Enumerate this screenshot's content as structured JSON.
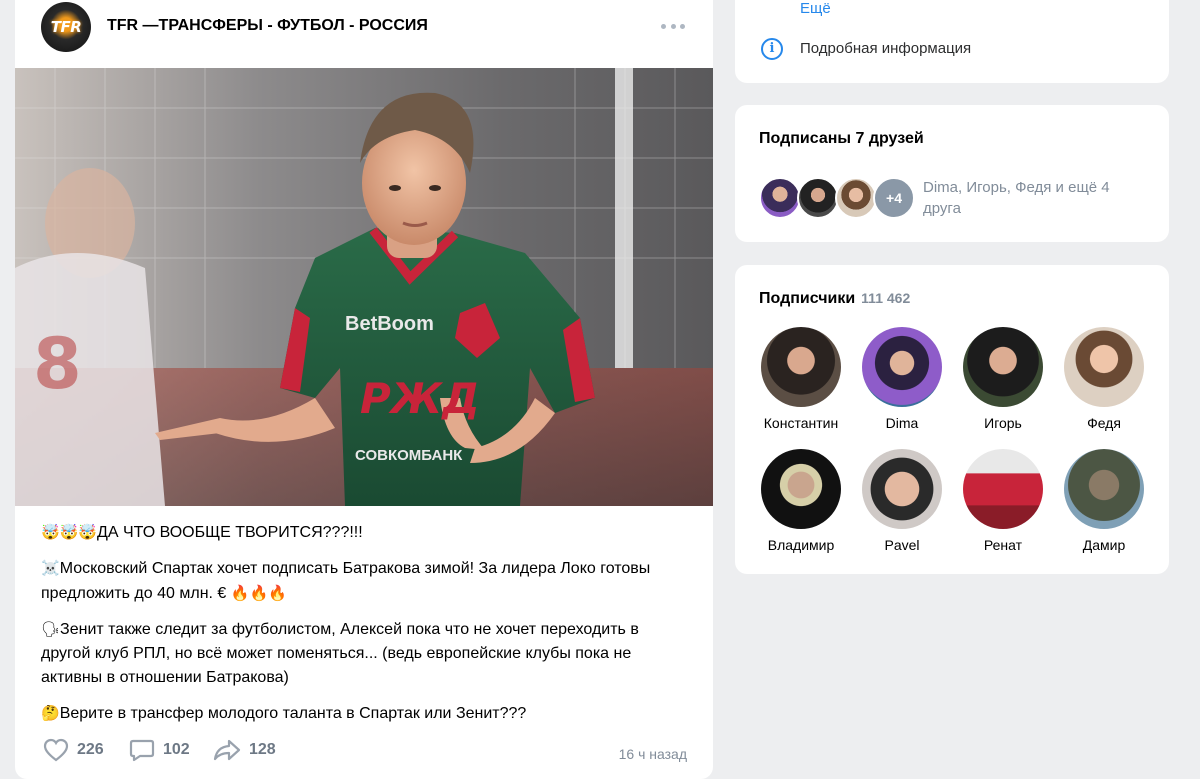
{
  "post": {
    "group_name": "TFR —ТРАНСФЕРЫ - ФУТБОЛ - РОССИЯ",
    "logo_text": "TFR",
    "photo_text": {
      "sponsor": "BetBoom",
      "chest": "РЖД",
      "bank": "СОВКОМБАНК"
    },
    "lines": [
      {
        "emoji": "🤯🤯🤯",
        "text": "ДА ЧТО ВООБЩЕ ТВОРИТСЯ???!!!"
      },
      {
        "emoji": "☠️",
        "text": "Московский Спартак хочет подписать Батракова зимой! За лидера Локо готовы предложить до 40 млн. €",
        "emoji_after": "🔥🔥🔥"
      },
      {
        "emoji": "🗣",
        "text": "Зенит также следит за футболистом, Алексей пока что не хочет переходить в другой клуб РПЛ, но всё может поменяться... (ведь европейские клубы пока не активны в отношении Батракова)"
      },
      {
        "emoji": "🤔",
        "text": "Верите в трансфер молодого таланта в Спартак или Зенит???"
      }
    ],
    "likes": "226",
    "comments": "102",
    "shares": "128",
    "timestamp": "16 ч назад"
  },
  "sidebar": {
    "more_label": "Ещё",
    "info_label": "Подробная информация",
    "friends": {
      "title": "Подписаны 7 друзей",
      "more_badge": "+4",
      "summary": "Dima, Игорь, Федя и ещё 4 друга"
    },
    "subscribers": {
      "title": "Подписчики",
      "count": "111 462",
      "people": [
        {
          "name": "Константин"
        },
        {
          "name": "Dima"
        },
        {
          "name": "Игорь"
        },
        {
          "name": "Федя"
        },
        {
          "name": "Владимир"
        },
        {
          "name": "Pavel"
        },
        {
          "name": "Ренат"
        },
        {
          "name": "Дамир"
        }
      ]
    }
  },
  "colors": {
    "page_bg": "#edeef0",
    "link_blue": "#2688eb",
    "secondary_text": "#818c99",
    "action_gray": "#6d7885",
    "kit_green": "#1f5a3c",
    "kit_red": "#c8243a"
  },
  "icons": [
    "more-dots-icon",
    "heart-icon",
    "comment-icon",
    "share-icon",
    "info-icon"
  ]
}
